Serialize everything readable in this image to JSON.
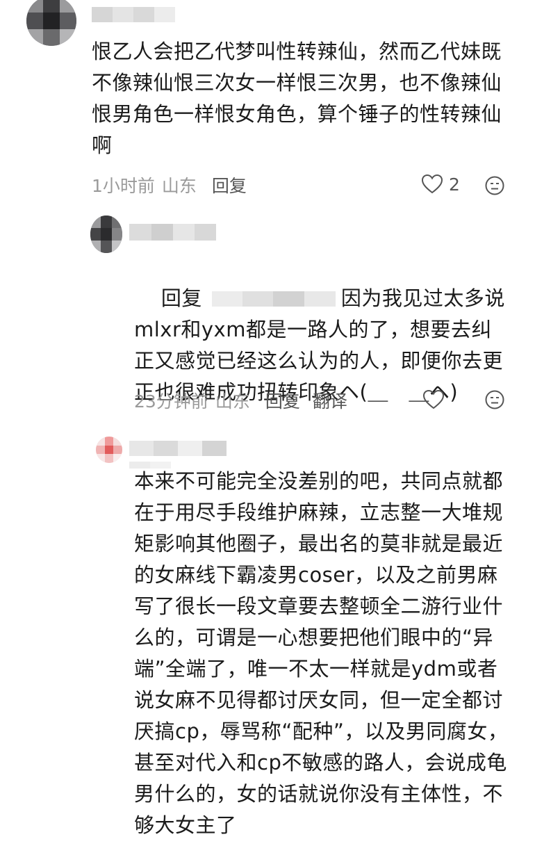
{
  "comments": [
    {
      "text": "恨乙人会把乙代梦叫性转辣仙，然而乙代妹既不像辣仙恨三次女一样恨三次男，也不像辣仙恨男角色一样恨女角色，算个锤子的性转辣仙啊",
      "time": "1小时前",
      "location": "山东",
      "reply_label": "回复",
      "likes": "2"
    },
    {
      "reply_prefix": "回复",
      "text": "因为我见过太多说mlxr和yxm都是一路人的了，想要去纠正又感觉已经这么认为的人，即便你去更正也很难成功扭转印象ヘ(＿　＿ヘ)",
      "time": "23分钟前",
      "location": "山东",
      "reply_label": "回复",
      "translate_label": "翻译"
    },
    {
      "text": "本来不可能完全没差别的吧，共同点就都在于用尽手段维护麻辣，立志整一大堆规矩影响其他圈子，最出名的莫非就是最近的女麻线下霸凌男coser，以及之前男麻写了很长一段文章要去整顿全二游行业什么的，可谓是一心想要把他们眼中的“异端”全端了，唯一不太一样就是ydm或者说女麻不见得都讨厌女同，但一定全都讨厌搞cp，辱骂称“配种”，以及男同腐女，甚至对代入和cp不敏感的路人，会说成龟男什么的，女的话就说你没有主体性，不够大女主了"
    }
  ]
}
